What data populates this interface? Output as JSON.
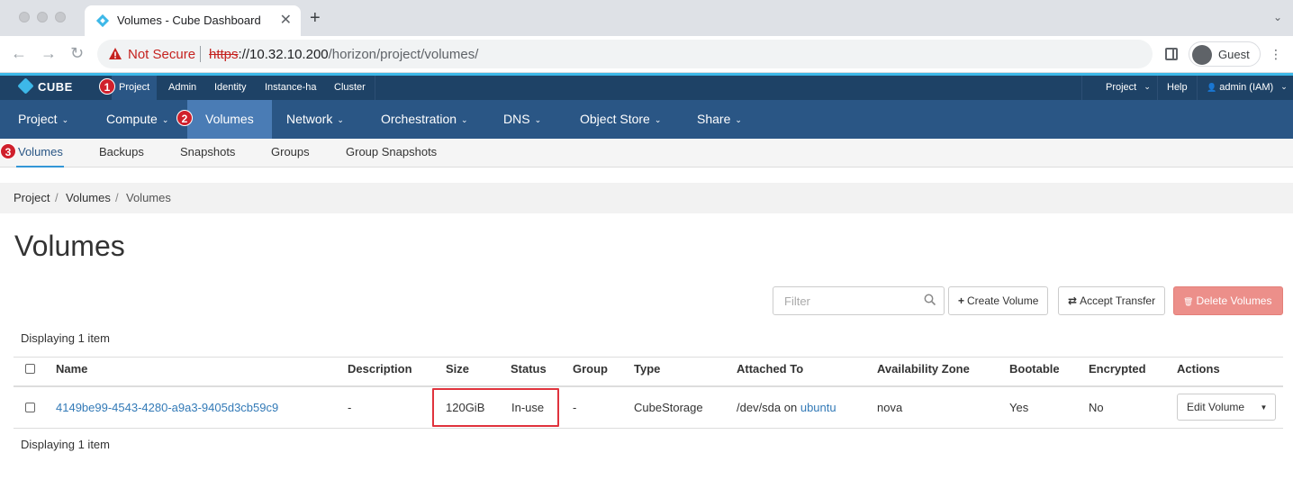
{
  "browser": {
    "tab_title": "Volumes - Cube Dashboard",
    "tab_close": "✕",
    "new_tab": "+",
    "tab_menu": "⌄",
    "back": "←",
    "forward": "→",
    "reload": "↻",
    "security_label": "Not Secure",
    "url_scheme": "https",
    "url_sep": "://",
    "url_host": "10.32.10.200",
    "url_path": "/horizon/project/volumes/",
    "profile_label": "Guest",
    "menu": "⋮"
  },
  "topbar": {
    "brand": "CUBE",
    "items": [
      "Project",
      "Admin",
      "Identity",
      "Instance-ha",
      "Cluster"
    ],
    "right": {
      "project_menu": "Project",
      "help": "Help",
      "user": "admin (IAM)"
    },
    "caret": "⌄",
    "user_icon": "👤"
  },
  "mainnav": {
    "items": [
      "Project",
      "Compute",
      "Volumes",
      "Network",
      "Orchestration",
      "DNS",
      "Object Store",
      "Share"
    ],
    "active": "Volumes",
    "chevron": "⌄"
  },
  "subnav": {
    "items": [
      "Volumes",
      "Backups",
      "Snapshots",
      "Groups",
      "Group Snapshots"
    ],
    "active": "Volumes"
  },
  "annotations": [
    "1",
    "2",
    "3"
  ],
  "breadcrumb": {
    "items": [
      "Project",
      "Volumes",
      "Volumes"
    ],
    "separator": "/"
  },
  "page_title": "Volumes",
  "actions": {
    "filter_placeholder": "Filter",
    "create_label": "Create Volume",
    "create_icon": "+",
    "transfer_label": "Accept Transfer",
    "transfer_icon": "⇄",
    "delete_label": "Delete Volumes",
    "delete_icon": "🗑"
  },
  "table": {
    "count_text": "Displaying 1 item",
    "columns": [
      "Name",
      "Description",
      "Size",
      "Status",
      "Group",
      "Type",
      "Attached To",
      "Availability Zone",
      "Bootable",
      "Encrypted",
      "Actions"
    ],
    "rows": [
      {
        "name": "4149be99-4543-4280-a9a3-9405d3cb59c9",
        "description": "-",
        "size": "120GiB",
        "status": "In-use",
        "group": "-",
        "type": "CubeStorage",
        "attached_prefix": "/dev/sda on",
        "attached_host": "ubuntu",
        "availability_zone": "nova",
        "bootable": "Yes",
        "encrypted": "No",
        "action_label": "Edit Volume",
        "action_caret": "▼"
      }
    ]
  }
}
